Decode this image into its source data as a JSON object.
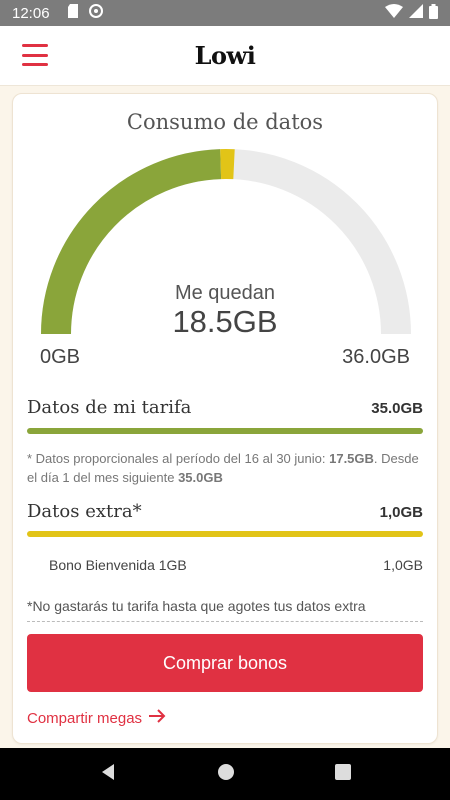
{
  "status_bar": {
    "time": "12:06",
    "icons_left": [
      "sd-card-icon",
      "data-saver-icon"
    ],
    "icons_right": [
      "wifi-icon",
      "signal-icon",
      "battery-icon"
    ]
  },
  "app_bar": {
    "logo": "Lowi",
    "menu_icon": "menu-icon"
  },
  "card": {
    "title": "Consumo de datos",
    "gauge": {
      "remaining_label": "Me quedan",
      "remaining_value": "18.5GB",
      "min_label": "0GB",
      "max_label": "36.0GB",
      "total_gb": 36.0,
      "green_used_fraction": 0.49,
      "yellow_used_fraction": 0.025,
      "colors": {
        "green": "#8aa53a",
        "yellow": "#e2c417",
        "track": "#ebebeb"
      }
    },
    "tariff": {
      "label": "Datos de mi tarifa",
      "amount": "35.0GB",
      "note_prefix": "* Datos proporcionales al período del 16 al 30 junio:",
      "note_value1": "17.5GB",
      "note_middle": ". Desde el día 1 del mes siguiente",
      "note_value2": "35.0GB"
    },
    "extra": {
      "label": "Datos extra*",
      "amount": "1,0GB",
      "items": [
        {
          "name": "Bono Bienvenida 1GB",
          "amount": "1,0GB"
        }
      ],
      "note": "*No gastarás tu tarifa hasta que agotes tus datos extra"
    },
    "buy_button": "Comprar bonos",
    "share_link": "Compartir megas"
  },
  "accent_color": "#e03142"
}
